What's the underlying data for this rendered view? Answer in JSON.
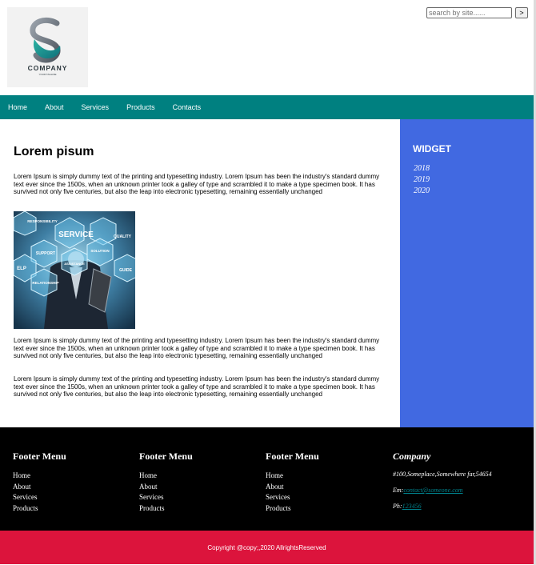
{
  "header": {
    "logo": {
      "company": "COMPANY",
      "tagline": "YOUR TAGLINE"
    },
    "search": {
      "placeholder": "search by site......",
      "button_label": ">"
    }
  },
  "nav": {
    "items": [
      "Home",
      "About",
      "Services",
      "Products",
      "Contacts"
    ]
  },
  "main": {
    "title": "Lorem pisum",
    "paragraphs": [
      "Lorem Ipsum is simply dummy text of the printing and typesetting industry. Lorem Ipsum has been the industry's standard dummy text ever since the 1500s, when an unknown printer took a galley of type and scrambled it to make a type specimen book. It has survived not only five centuries, but also the leap into electronic typesetting, remaining essentially unchanged",
      "Lorem Ipsum is simply dummy text of the printing and typesetting industry. Lorem Ipsum has been the industry's standard dummy text ever since the 1500s, when an unknown printer took a galley of type and scrambled it to make a type specimen book. It has survived not only five centuries, but also the leap into electronic typesetting, remaining essentially unchanged",
      "Lorem Ipsum is simply dummy text of the printing and typesetting industry. Lorem Ipsum has been the industry's standard dummy text ever since the 1500s, when an unknown printer took a galley of type and scrambled it to make a type specimen book. It has survived not only five centuries, but also the leap into electronic typesetting, remaining essentially unchanged"
    ],
    "image_labels": [
      "RESPONSIBILITY",
      "SERVICE",
      "QUALITY",
      "SUPPORT",
      "SOLUTION",
      "ELP",
      "ASSISTANCE",
      "GUIDE",
      "RELATIONSHIP"
    ]
  },
  "sidebar": {
    "title": "WIDGET",
    "items": [
      "2018",
      "2019",
      "2020"
    ]
  },
  "footer": {
    "menus": [
      {
        "title": "Footer Menu",
        "items": [
          "Home",
          "About",
          "Services",
          "Products"
        ]
      },
      {
        "title": "Footer Menu",
        "items": [
          "Home",
          "About",
          "Services",
          "Products"
        ]
      },
      {
        "title": "Footer Menu",
        "items": [
          "Home",
          "About",
          "Services",
          "Products"
        ]
      }
    ],
    "company": {
      "title": "Company",
      "address": "#100,Someplace,Somewhere far,54654",
      "email_label": "Em:",
      "email": "contact@someone.com",
      "phone_label": "Ph:",
      "phone": "123456"
    }
  },
  "copyright": "Copyright @copy;,2020 AllrightsReserved",
  "colors": {
    "nav": "#008080",
    "sidebar": "#4169e1",
    "footer": "#000000",
    "copyright": "#dc143c",
    "link": "#00808b"
  }
}
